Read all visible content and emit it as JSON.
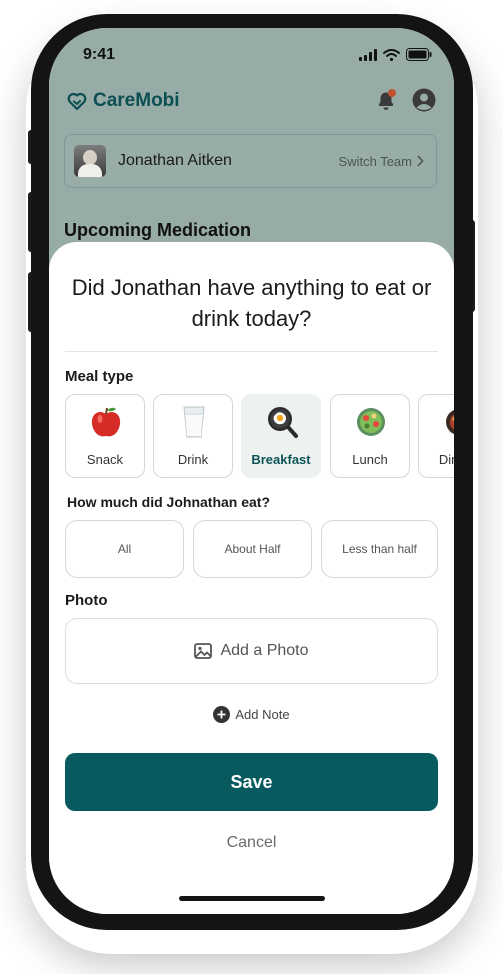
{
  "status_bar": {
    "time": "9:41"
  },
  "header": {
    "brand": "CareMobi"
  },
  "profile": {
    "name": "Jonathan Aitken",
    "switch_label": "Switch Team"
  },
  "page": {
    "section_title": "Upcoming Medication"
  },
  "sheet": {
    "question": "Did Jonathan have anything to eat or drink today?",
    "meal_type_label": "Meal type",
    "meals": [
      {
        "label": "Snack",
        "icon": "apple-icon",
        "selected": false
      },
      {
        "label": "Drink",
        "icon": "milk-glass-icon",
        "selected": false
      },
      {
        "label": "Breakfast",
        "icon": "frying-pan-egg-icon",
        "selected": true
      },
      {
        "label": "Lunch",
        "icon": "salad-bowl-icon",
        "selected": false
      },
      {
        "label": "Dinner",
        "icon": "dinner-plate-icon",
        "selected": false
      }
    ],
    "amount_label": "How much did Johnathan eat?",
    "amounts": [
      "All",
      "About Half",
      "Less than half"
    ],
    "photo_label": "Photo",
    "add_photo": "Add a Photo",
    "add_note": "Add Note",
    "save": "Save",
    "cancel": "Cancel"
  },
  "colors": {
    "brand": "#0c4f52",
    "primary_button": "#075a5e",
    "backdrop": "#97aca7",
    "selected_tile": "#edf2f1"
  }
}
